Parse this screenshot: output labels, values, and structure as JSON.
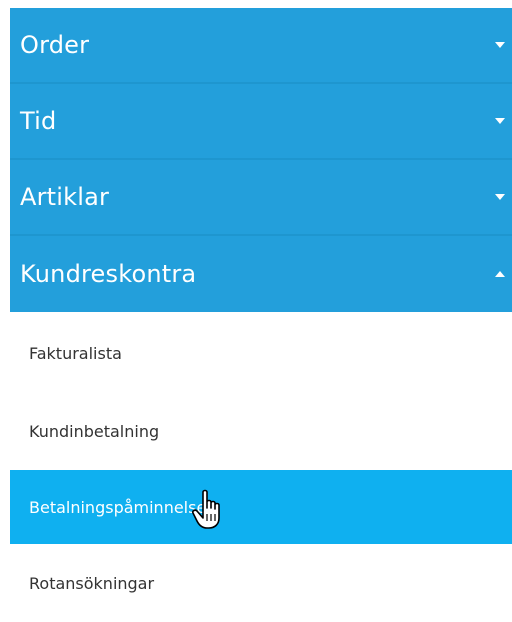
{
  "menu": {
    "sections": [
      {
        "label": "Order",
        "icon": "chevron-down-icon"
      },
      {
        "label": "Tid",
        "icon": "chevron-down-icon"
      },
      {
        "label": "Artiklar",
        "icon": "chevron-down-icon"
      },
      {
        "label": "Kundreskontra",
        "icon": "chevron-up-icon",
        "expanded": true
      }
    ],
    "sub_items": [
      {
        "label": "Fakturalista"
      },
      {
        "label": "Kundinbetalning"
      },
      {
        "label": "Betalningspåminnelse",
        "active": true
      },
      {
        "label": "Rotansökningar"
      }
    ]
  },
  "colors": {
    "header_bg": "#239fdb",
    "active_bg": "#0fb0f0",
    "header_text": "#ffffff",
    "item_text": "#333333"
  },
  "cursor": "hand-pointer-icon"
}
